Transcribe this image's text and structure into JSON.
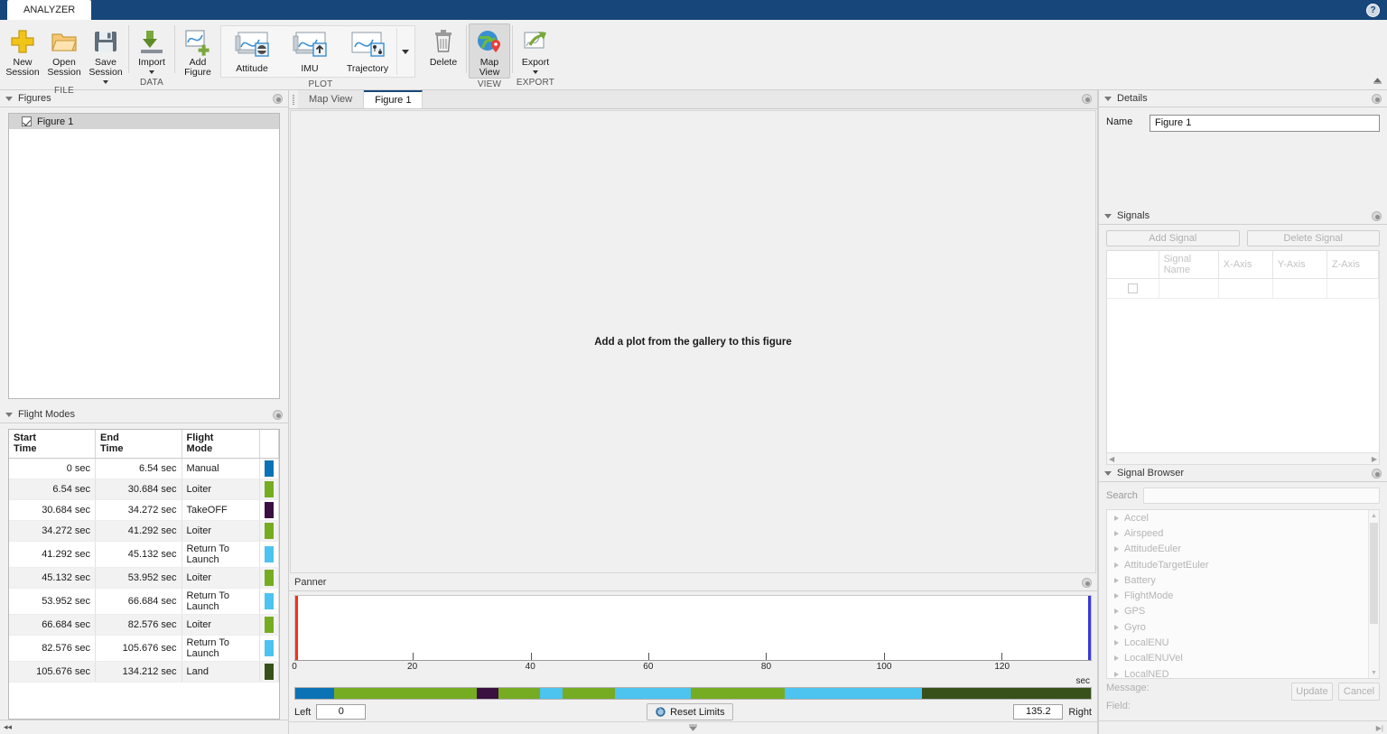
{
  "titlebar": {
    "tab_label": "ANALYZER",
    "help_icon": "help-question-icon"
  },
  "ribbon": {
    "groups": [
      {
        "name": "FILE",
        "label": "FILE",
        "buttons": [
          {
            "label": "New\nSession",
            "icon": "plus-sign-icon",
            "dropdown": false
          },
          {
            "label": "Open\nSession",
            "icon": "folder-open-icon",
            "dropdown": false
          },
          {
            "label": "Save\nSession",
            "icon": "floppy-disk-icon",
            "dropdown": true
          }
        ]
      },
      {
        "name": "DATA",
        "label": "DATA",
        "buttons": [
          {
            "label": "Import",
            "icon": "import-download-icon",
            "dropdown": true
          }
        ]
      },
      {
        "name": "PLOT",
        "label": "PLOT",
        "buttons": [
          {
            "label": "Add\nFigure",
            "icon": "add-figure-icon",
            "dropdown": false
          }
        ],
        "gallery": [
          {
            "label": "Attitude",
            "icon": "attitude-plot-icon"
          },
          {
            "label": "IMU",
            "icon": "imu-plot-icon"
          },
          {
            "label": "Trajectory",
            "icon": "trajectory-plot-icon"
          }
        ],
        "gallery_more_icon": "chevron-down-icon",
        "delete": {
          "label": "Delete",
          "icon": "trash-can-icon"
        }
      },
      {
        "name": "VIEW",
        "label": "VIEW",
        "buttons": [
          {
            "label": "Map\nView",
            "icon": "globe-map-pin-icon",
            "dropdown": false,
            "active": true
          }
        ]
      },
      {
        "name": "EXPORT",
        "label": "EXPORT",
        "buttons": [
          {
            "label": "Export",
            "icon": "export-arrow-icon",
            "dropdown": true
          }
        ]
      }
    ],
    "collapse_icon": "collapse-ribbon-icon"
  },
  "figures_panel": {
    "title": "Figures",
    "settings_icon": "panel-options-icon",
    "items": [
      {
        "label": "Figure 1",
        "checked": true
      }
    ]
  },
  "flight_modes_panel": {
    "title": "Flight Modes",
    "settings_icon": "panel-options-icon",
    "columns": [
      "Start\nTime",
      "End\nTime",
      "Flight\nMode",
      ""
    ],
    "rows": [
      {
        "start": "0 sec",
        "end": "6.54 sec",
        "mode": "Manual",
        "color": "#0b72b5"
      },
      {
        "start": "6.54 sec",
        "end": "30.684 sec",
        "mode": "Loiter",
        "color": "#76ac22"
      },
      {
        "start": "30.684 sec",
        "end": "34.272 sec",
        "mode": "TakeOFF",
        "color": "#3a1040"
      },
      {
        "start": "34.272 sec",
        "end": "41.292 sec",
        "mode": "Loiter",
        "color": "#76ac22"
      },
      {
        "start": "41.292 sec",
        "end": "45.132 sec",
        "mode": "Return To Launch",
        "color": "#4dc3f0"
      },
      {
        "start": "45.132 sec",
        "end": "53.952 sec",
        "mode": "Loiter",
        "color": "#76ac22"
      },
      {
        "start": "53.952 sec",
        "end": "66.684 sec",
        "mode": "Return To Launch",
        "color": "#4dc3f0"
      },
      {
        "start": "66.684 sec",
        "end": "82.576 sec",
        "mode": "Loiter",
        "color": "#76ac22"
      },
      {
        "start": "82.576 sec",
        "end": "105.676 sec",
        "mode": "Return To Launch",
        "color": "#4dc3f0"
      },
      {
        "start": "105.676 sec",
        "end": "134.212 sec",
        "mode": "Land",
        "color": "#38511a"
      }
    ]
  },
  "figure_tabs": {
    "tabs": [
      {
        "label": "Map View",
        "active": false
      },
      {
        "label": "Figure 1",
        "active": true
      }
    ],
    "settings_icon": "panel-options-icon",
    "canvas_message": "Add a plot from the gallery to this figure"
  },
  "panner": {
    "title": "Panner",
    "settings_icon": "panel-options-icon",
    "axis_unit": "sec",
    "ticks": [
      0,
      20,
      40,
      60,
      80,
      100,
      120
    ],
    "axis_min": 0,
    "axis_max": 135.2,
    "left_label": "Left",
    "left_value": "0",
    "right_label": "Right",
    "right_value": "135.2",
    "reset_button": "Reset Limits",
    "reset_icon": "reset-limits-icon",
    "left_marker_color": "#ff2d1a",
    "right_marker_color": "#3a36e0"
  },
  "details_panel": {
    "title": "Details",
    "settings_icon": "panel-options-icon",
    "name_label": "Name",
    "name_value": "Figure 1"
  },
  "signals_panel": {
    "title": "Signals",
    "settings_icon": "panel-options-icon",
    "add_button": "Add Signal",
    "delete_button": "Delete Signal",
    "columns": [
      "",
      "Signal Name",
      "X-Axis",
      "Y-Axis",
      "Z-Axis"
    ],
    "rows": [
      {
        "checked": false,
        "signal_name": "",
        "x_axis": "",
        "y_axis": "",
        "z_axis": ""
      }
    ]
  },
  "signal_browser": {
    "title": "Signal Browser",
    "settings_icon": "panel-options-icon",
    "search_label": "Search",
    "search_value": "",
    "items": [
      "Accel",
      "Airspeed",
      "AttitudeEuler",
      "AttitudeTargetEuler",
      "Battery",
      "FlightMode",
      "GPS",
      "Gyro",
      "LocalENU",
      "LocalENUVel",
      "LocalNED"
    ],
    "message_label": "Message:",
    "field_label": "Field:",
    "update_button": "Update",
    "cancel_button": "Cancel"
  },
  "chart_data": {
    "type": "bar",
    "title": "Flight Mode Timeline",
    "xlabel": "sec",
    "ylabel": "",
    "xlim": [
      0,
      135.2
    ],
    "grid": false,
    "legend": "none",
    "categories": [
      "Manual",
      "Loiter",
      "TakeOFF",
      "Loiter",
      "Return To Launch",
      "Loiter",
      "Return To Launch",
      "Loiter",
      "Return To Launch",
      "Land"
    ],
    "segments": [
      {
        "mode": "Manual",
        "start": 0,
        "end": 6.54,
        "duration": 6.54,
        "color": "#0b72b5"
      },
      {
        "mode": "Loiter",
        "start": 6.54,
        "end": 30.684,
        "duration": 24.144,
        "color": "#76ac22"
      },
      {
        "mode": "TakeOFF",
        "start": 30.684,
        "end": 34.272,
        "duration": 3.588,
        "color": "#3a1040"
      },
      {
        "mode": "Loiter",
        "start": 34.272,
        "end": 41.292,
        "duration": 7.02,
        "color": "#76ac22"
      },
      {
        "mode": "Return To Launch",
        "start": 41.292,
        "end": 45.132,
        "duration": 3.84,
        "color": "#4dc3f0"
      },
      {
        "mode": "Loiter",
        "start": 45.132,
        "end": 53.952,
        "duration": 8.82,
        "color": "#76ac22"
      },
      {
        "mode": "Return To Launch",
        "start": 53.952,
        "end": 66.684,
        "duration": 12.732,
        "color": "#4dc3f0"
      },
      {
        "mode": "Loiter",
        "start": 66.684,
        "end": 82.576,
        "duration": 15.892,
        "color": "#76ac22"
      },
      {
        "mode": "Return To Launch",
        "start": 82.576,
        "end": 105.676,
        "duration": 23.1,
        "color": "#4dc3f0"
      },
      {
        "mode": "Land",
        "start": 105.676,
        "end": 134.212,
        "duration": 28.536,
        "color": "#38511a"
      }
    ],
    "tick_labels": [
      "0",
      "20",
      "40",
      "60",
      "80",
      "100",
      "120"
    ]
  }
}
